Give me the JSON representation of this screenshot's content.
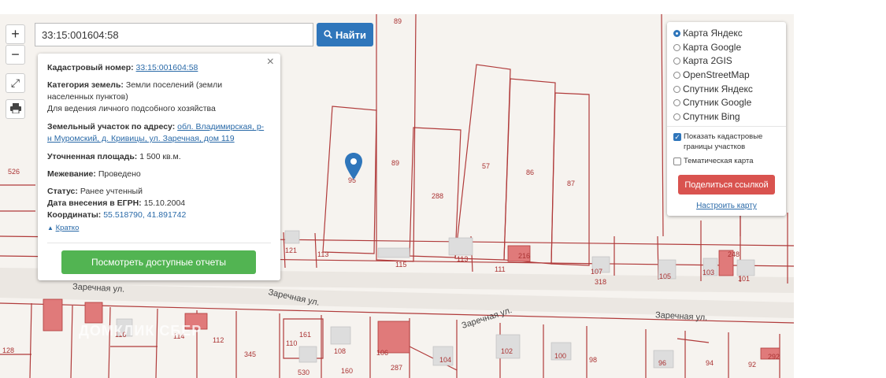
{
  "search": {
    "value": "33:15:001604:58",
    "button_label": "Найти"
  },
  "zoom": {
    "plus": "+",
    "minus": "−"
  },
  "tools": {
    "fullscreen_icon": "expand-icon",
    "print_icon": "print-icon"
  },
  "popup": {
    "cadastral_label": "Кадастровый номер:",
    "cadastral_value": "33:15:001604:58",
    "category_label": "Категория земель:",
    "category_value": "Земли поселений (земли",
    "category_value2": "населенных пунктов)",
    "category_value3": "Для ведения личного подсобного хозяйства",
    "address_label": "Земельный участок по адресу:",
    "address_value": "обл. Владимирская, р-",
    "address_value2": "н Муромский, д. Кривицы, ул. Заречная, дом 119",
    "area_label": "Уточненная площадь:",
    "area_value": "1 500 кв.м.",
    "survey_label": "Межевание:",
    "survey_value": "Проведено",
    "status_label": "Статус:",
    "status_value": "Ранее учтенный",
    "date_label": "Дата внесения в ЕГРН:",
    "date_value": "15.10.2004",
    "coords_label": "Координаты:",
    "coords_value": "55.518790, 41.891742",
    "collapse_link": "Кратко",
    "report_button": "Посмотреть доступные отчеты",
    "close": "×"
  },
  "layers": {
    "options": [
      "Карта Яндекс",
      "Карта Google",
      "Карта 2GIS",
      "OpenStreetMap",
      "Спутник Яндекс",
      "Спутник Google",
      "Спутник Bing"
    ],
    "selected": "Карта Яндекс",
    "show_borders": "Показать кадастровые границы участков",
    "thematic": "Тематическая карта",
    "share_button": "Поделиться ссылкой",
    "configure_link": "Настроить карту"
  },
  "map": {
    "street_labels": [
      "Заречная ул.",
      "Заречная ул.",
      "Заречная ул.",
      "Заречная ул."
    ],
    "parcel_numbers": [
      "89",
      "89",
      "57",
      "86",
      "87",
      "288",
      "95",
      "526",
      "121",
      "113",
      "115",
      "113",
      "111",
      "216",
      "107",
      "318",
      "105",
      "103",
      "101",
      "128",
      "116",
      "114",
      "112",
      "345",
      "161",
      "110",
      "108",
      "106",
      "530",
      "160",
      "287",
      "104",
      "102",
      "100",
      "98",
      "96",
      "94",
      "92",
      "292",
      "248"
    ],
    "watermark": "ДОМКЛИК СБЕР",
    "colors": {
      "border": "#b03a3a",
      "building": "#e07a7a",
      "road": "#d9d4ce"
    }
  }
}
